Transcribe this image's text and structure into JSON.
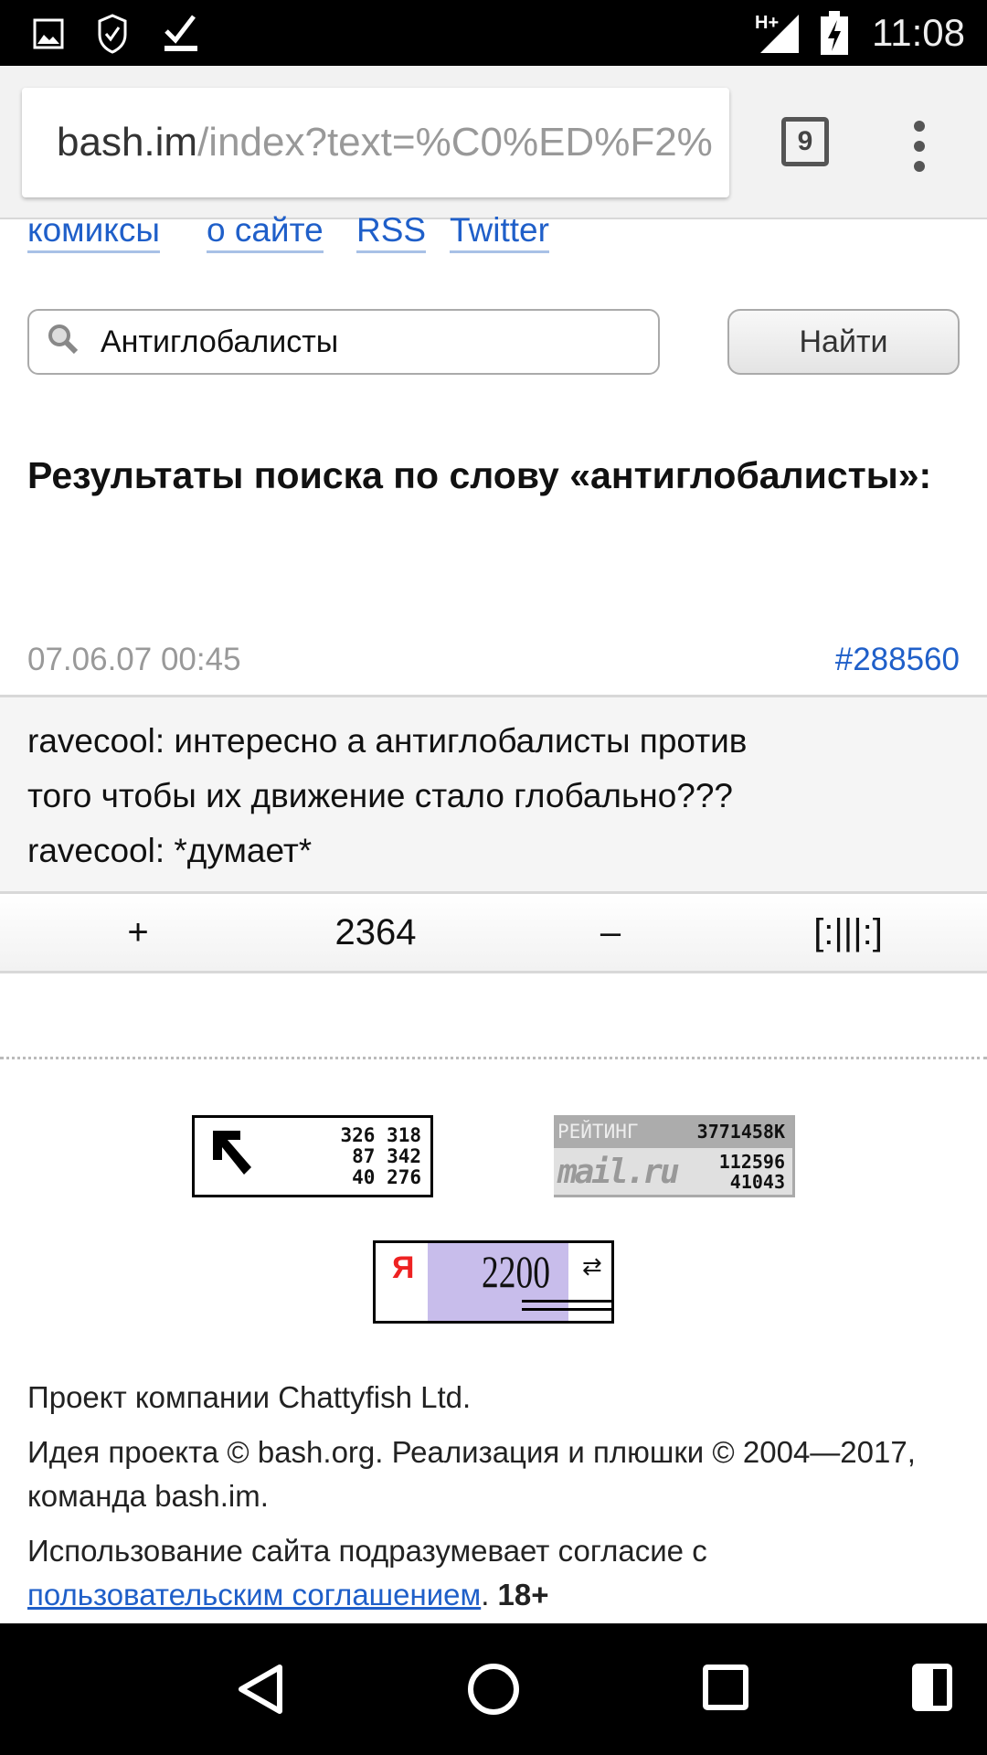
{
  "status_bar": {
    "time": "11:08",
    "network": "H+",
    "icons": [
      "image-icon",
      "shield-check-icon",
      "download-done-icon",
      "signal-icon",
      "battery-charging-icon"
    ]
  },
  "browser": {
    "url_host": "bash.im",
    "url_path": "/index?text=%C0%ED%F2%",
    "tab_count": "9"
  },
  "nav": {
    "links": [
      "комиксы",
      "о сайте",
      "RSS",
      "Twitter"
    ]
  },
  "search": {
    "value": "Антиглобалисты",
    "button": "Найти"
  },
  "heading": "Результаты поиска по слову «антиглобалисты»:",
  "quote": {
    "date": "07.06.07 00:45",
    "id": "#288560",
    "lines": [
      "ravecool: интересно а антиглобалисты против",
      "того чтобы их движение стало глобально???",
      "ravecool: *думает*"
    ],
    "plus": "+",
    "rating": "2364",
    "minus": "–",
    "bayan": "[:|||:]"
  },
  "counters": {
    "liveinternet": [
      "326 318",
      "87 342",
      "40 276"
    ],
    "mailru": {
      "label": "РЕЙТИНГ",
      "total": "3771458K",
      "values": [
        "112596",
        "41043"
      ],
      "logo": "mail.ru"
    },
    "yandex": {
      "letter": "Я",
      "value": "2200"
    }
  },
  "footer": {
    "line1": "Проект компании Chattyfish Ltd.",
    "line2": "Идея проекта © bash.org. Реализация и плюшки © 2004—2017, команда bash.im.",
    "line3_pre": "Использование сайта подразумевает согласие с ",
    "line3_link": "пользовательским соглашением",
    "line3_post": ". ",
    "age": "18+"
  },
  "colors": {
    "link": "#1f5fc9",
    "quote_bg": "#f5f5f5"
  }
}
